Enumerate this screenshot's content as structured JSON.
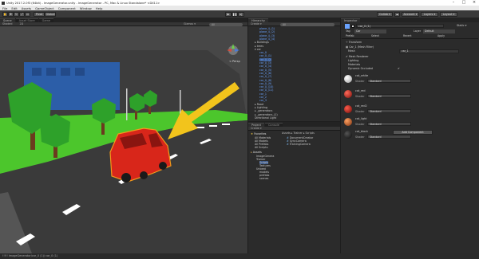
{
  "window": {
    "title": "Unity 2017.2.0f3 (64bit) - ImageGenerator.unity - ImageGenerator - PC, Mac & Linux Standalone* <DX11>"
  },
  "menu": [
    "File",
    "Edit",
    "Assets",
    "GameObject",
    "Component",
    "Window",
    "Help"
  ],
  "toolbar": {
    "pivot": "Pivot",
    "global": "Global",
    "collab": "Collab ▾",
    "account": "Account ▾",
    "layers": "Layers ▾",
    "layout": "Layout ▾"
  },
  "scene": {
    "tabs": [
      "Scene",
      "Asset Store",
      "Game"
    ],
    "shading": "Shaded",
    "mode": "2D",
    "gizmos": "Gizmos ▾",
    "search": "All",
    "persp": "< Persp"
  },
  "hierarchy": {
    "tab": "Hierarchy",
    "create": "Create ▾",
    "search": "All",
    "items": [
      {
        "label": "plane_4_(1)",
        "blue": true
      },
      {
        "label": "plane_4_(2)",
        "blue": true
      },
      {
        "label": "plane_4_(3)",
        "blue": true
      },
      {
        "label": "plane_4_(4)",
        "blue": true
      },
      {
        "label": "▸ Buildings",
        "blue": false
      },
      {
        "label": "▸ trees",
        "blue": false
      },
      {
        "label": "▾ car",
        "blue": false
      },
      {
        "label": "car_0",
        "blue": true
      },
      {
        "label": "car_0_(1)",
        "blue": true
      },
      {
        "label": "car_0_(2)",
        "blue": true
      },
      {
        "label": "car_0_(3)",
        "blue": true
      },
      {
        "label": "car_0_(4)",
        "blue": true
      },
      {
        "label": "car_0_(5)",
        "blue": true
      },
      {
        "label": "car_0_(6)",
        "blue": true
      },
      {
        "label": "car_0_(7)",
        "blue": true
      },
      {
        "label": "car_0_(8)",
        "blue": true
      },
      {
        "label": "car_0_(9)",
        "blue": true
      },
      {
        "label": "car_0_(10)",
        "blue": true
      },
      {
        "label": "car_0_(11)",
        "blue": true
      },
      {
        "label": "car_1",
        "blue": true
      },
      {
        "label": "car_2",
        "blue": true
      },
      {
        "label": "car_3",
        "blue": true
      },
      {
        "label": "▸ Road",
        "blue": false
      },
      {
        "label": "▸ Lighting",
        "blue": false
      },
      {
        "label": "▸ _generators",
        "blue": false
      },
      {
        "label": "▸ _generators_(1)",
        "blue": false
      },
      {
        "label": "Directional Light",
        "blue": false
      }
    ]
  },
  "project": {
    "tabs": [
      "Project",
      "Console"
    ],
    "create": "Create ▾",
    "breadcrumb": "Assets ▸ Trainer ▸ Scripts",
    "favorites_title": "Favorites",
    "favorites": [
      "All Materials",
      "All Models",
      "All Prefabs",
      "All Scripts"
    ],
    "assets_title": "Assets",
    "assets_tree": [
      "ImageGenera",
      "Trainer",
      "Scripts",
      "Textures",
      "Unbeat",
      "models",
      "prefabs",
      "scenes"
    ],
    "files": [
      "DocumentCreator",
      "SyncCamera",
      "TrainingCamera"
    ]
  },
  "inspector": {
    "tab": "Inspector",
    "object_name": "car_0 (1)",
    "static": "Static ▾",
    "tag_label": "Tag",
    "tag_value": "Car",
    "layer_label": "Layer",
    "layer_value": "Default",
    "prefab_label": "Prefab",
    "prefab_select": "Select",
    "prefab_revert": "Revert",
    "prefab_apply": "Apply",
    "components": [
      "Transform",
      "Car_1 (Mesh Filter)"
    ],
    "mesh_label": "Mesh",
    "mesh_value": "car_1",
    "renderer": "Mesh Renderer",
    "renderer_rows": [
      "Lighting",
      "Materials",
      "Dynamic Occluded"
    ],
    "materials": [
      {
        "name": "cat_white",
        "shader": "Standard",
        "color": "#e8e8e8"
      },
      {
        "name": "cat_red",
        "shader": "Standard",
        "color": "#c0251c"
      },
      {
        "name": "cat_red2",
        "shader": "Standard",
        "color": "#b02018"
      },
      {
        "name": "cat_light",
        "shader": "Standard",
        "color": "#d06a28"
      },
      {
        "name": "cat_black",
        "shader": "Standard",
        "color": "#1a1a1a"
      }
    ],
    "shader_label": "Shader",
    "add_component": "Add Component"
  },
  "status": {
    "text": "!!!!! ImageGenerator/car_0 (1)/ car_0 (1)"
  },
  "colors": {
    "sky": "#2c5ea8",
    "grass": "#4cc62c",
    "road": "#3a3a3a",
    "car": "#d8261a",
    "arrow": "#f2c41c"
  }
}
